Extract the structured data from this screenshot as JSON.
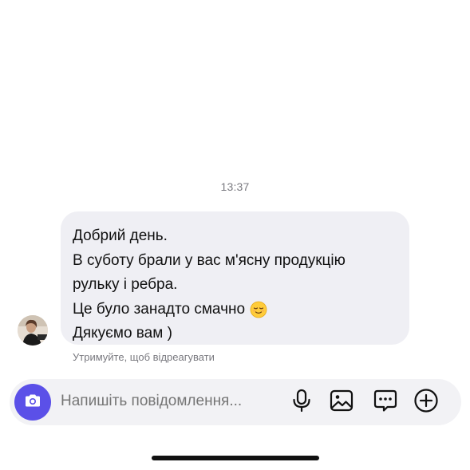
{
  "conversation": {
    "timestamp": "13:37",
    "message": {
      "lines": [
        "Добрий день.",
        "В суботу брали у вас м'ясну продукцію",
        "рульку і ребра.",
        "Це було занадто смачно",
        "Дякуємо вам )"
      ],
      "emoji": "relieved-face-emoji"
    },
    "hold_hint": "Утримуйте, щоб відреагувати"
  },
  "composer": {
    "placeholder": "Напишіть повідомлення...",
    "icons": [
      "camera-icon",
      "microphone-icon",
      "gallery-icon",
      "sticker-icon",
      "plus-icon"
    ],
    "accent_color": "#5b50e8"
  }
}
